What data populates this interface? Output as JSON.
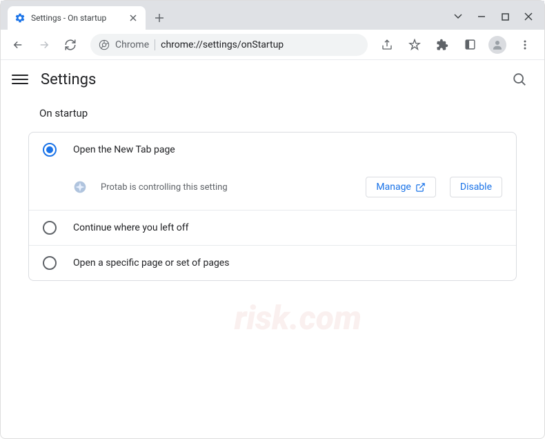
{
  "tab": {
    "title": "Settings - On startup"
  },
  "address": {
    "origin": "Chrome",
    "path": "chrome://settings/onStartup"
  },
  "header": {
    "title": "Settings"
  },
  "section": {
    "title": "On startup"
  },
  "options": {
    "new_tab": "Open the New Tab page",
    "continue": "Continue where you left off",
    "specific": "Open a specific page or set of pages"
  },
  "extension_notice": {
    "text": "Protab is controlling this setting",
    "manage": "Manage",
    "disable": "Disable"
  },
  "colors": {
    "accent": "#1a73e8"
  }
}
